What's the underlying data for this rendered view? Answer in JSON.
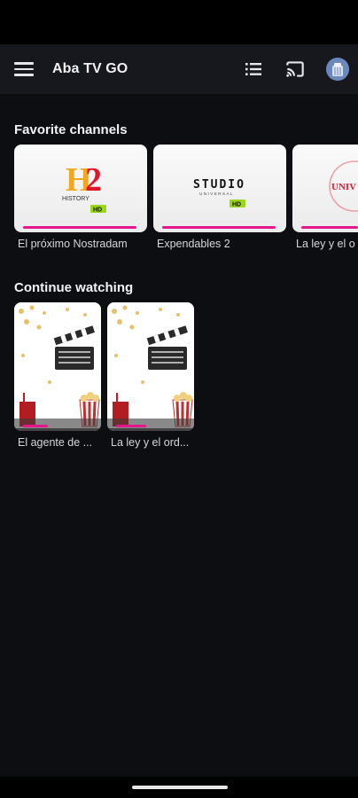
{
  "app": {
    "title": "Aba TV GO",
    "accent_color": "#e6168c",
    "icons": [
      "menu-icon",
      "list-icon",
      "cast-icon",
      "avatar"
    ]
  },
  "favorites": {
    "title": "Favorite channels",
    "channels": [
      {
        "logo_text": "H2",
        "logo_sub": "HISTORY",
        "badge": "HD",
        "program": "El próximo Nostradam",
        "progress": 0.92
      },
      {
        "logo_text": "STUDIO",
        "logo_sub": "UNIVERSAL",
        "badge": "HD",
        "program": "Expendables 2",
        "progress": 0.92
      },
      {
        "logo_text": "UNIV",
        "program": "La ley y el o",
        "progress": 0.6
      }
    ]
  },
  "continue_watching": {
    "title": "Continue watching",
    "items": [
      {
        "title": "El agente de ...",
        "progress": 0.35
      },
      {
        "title": "La ley y el ord...",
        "progress": 0.4
      }
    ]
  }
}
